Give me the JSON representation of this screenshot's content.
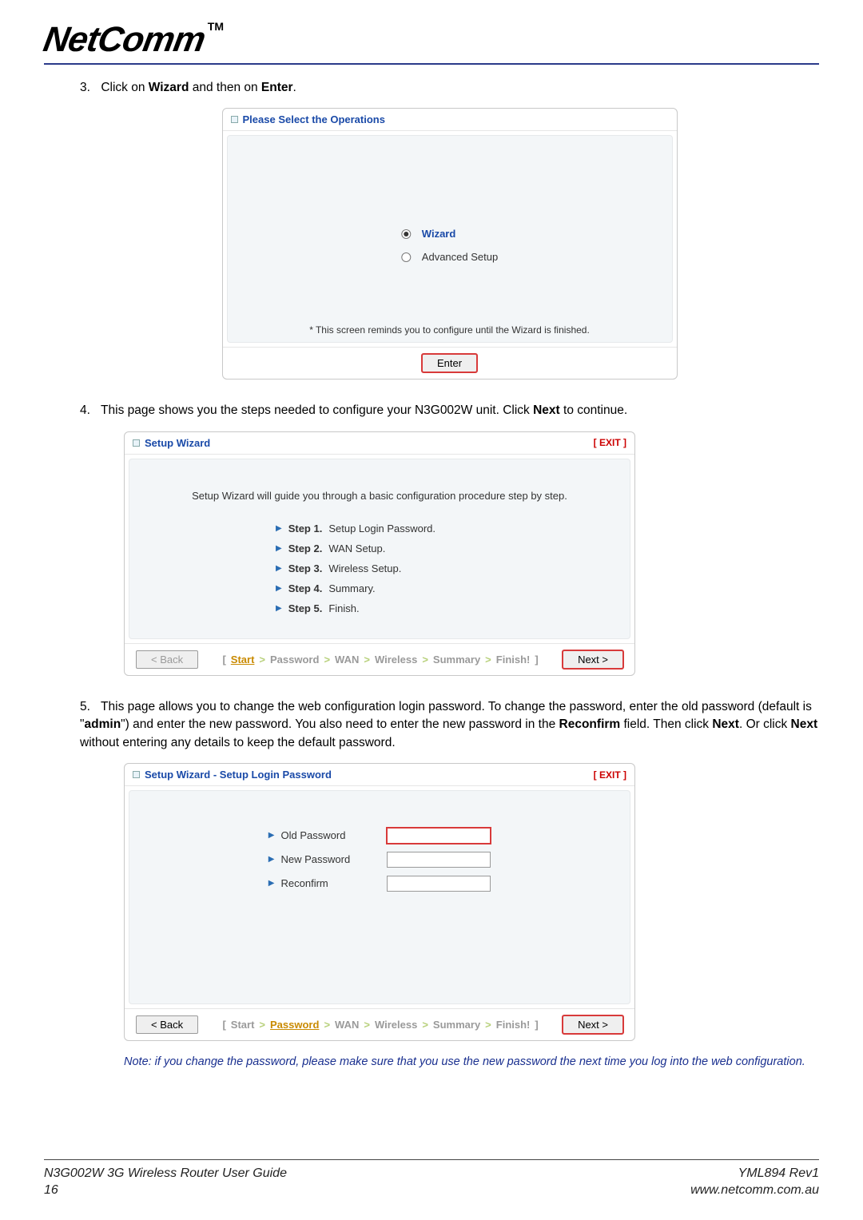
{
  "header": {
    "logo": "NetComm",
    "tm": "TM"
  },
  "step3": {
    "num": "3.",
    "text_pre": "Click on ",
    "bold1": "Wizard",
    "text_mid": " and then on ",
    "bold2": "Enter",
    "text_post": "."
  },
  "panel1": {
    "title": "Please Select the Operations",
    "opt1": "Wizard",
    "opt2": "Advanced Setup",
    "reminder": "* This screen reminds you to configure until the Wizard is finished.",
    "enter": "Enter"
  },
  "step4": {
    "num": "4.",
    "text_a": "This page shows you the steps needed to configure your N3G002W unit. Click ",
    "bold": "Next",
    "text_b": " to continue."
  },
  "panel2": {
    "title": "Setup Wizard",
    "exit": "[ EXIT ]",
    "intro": "Setup Wizard will guide you through a basic configuration procedure step by step.",
    "s1a": "Step 1.",
    "s1b": "Setup Login Password.",
    "s2a": "Step 2.",
    "s2b": "WAN Setup.",
    "s3a": "Step 3.",
    "s3b": "Wireless Setup.",
    "s4a": "Step 4.",
    "s4b": "Summary.",
    "s5a": "Step 5.",
    "s5b": "Finish.",
    "back": "< Back",
    "next": "Next >",
    "bc": {
      "b0": "[",
      "start": "Start",
      "sep": ">",
      "pwd": "Password",
      "wan": "WAN",
      "wl": "Wireless",
      "sum": "Summary",
      "fin": "Finish!",
      "b1": "]"
    }
  },
  "step5": {
    "num": "5.",
    "t1": "This page allows you to change the web configuration login password. To change the password, enter the old password (default is \"",
    "admin": "admin",
    "t2": "\") and enter the new password. You also need to enter the new password in the ",
    "reconfirm": "Reconfirm",
    "t3": " field. Then click ",
    "next1": "Next",
    "t4": ". Or click ",
    "next2": "Next",
    "t5": " without entering any details to keep the default password."
  },
  "panel3": {
    "title": "Setup Wizard - Setup Login Password",
    "exit": "[ EXIT ]",
    "l1": "Old Password",
    "l2": "New Password",
    "l3": "Reconfirm",
    "back": "< Back",
    "next": "Next >",
    "bc": {
      "b0": "[",
      "start": "Start",
      "sep": ">",
      "pwd": "Password",
      "wan": "WAN",
      "wl": "Wireless",
      "sum": "Summary",
      "fin": "Finish!",
      "b1": "]"
    }
  },
  "note": "Note: if you change the password, please make sure that you use the new password the next time you log into the web configuration.",
  "footer": {
    "left1": "N3G002W 3G Wireless Router User Guide",
    "left2": "16",
    "right1": "YML894 Rev1",
    "right2": "www.netcomm.com.au"
  }
}
